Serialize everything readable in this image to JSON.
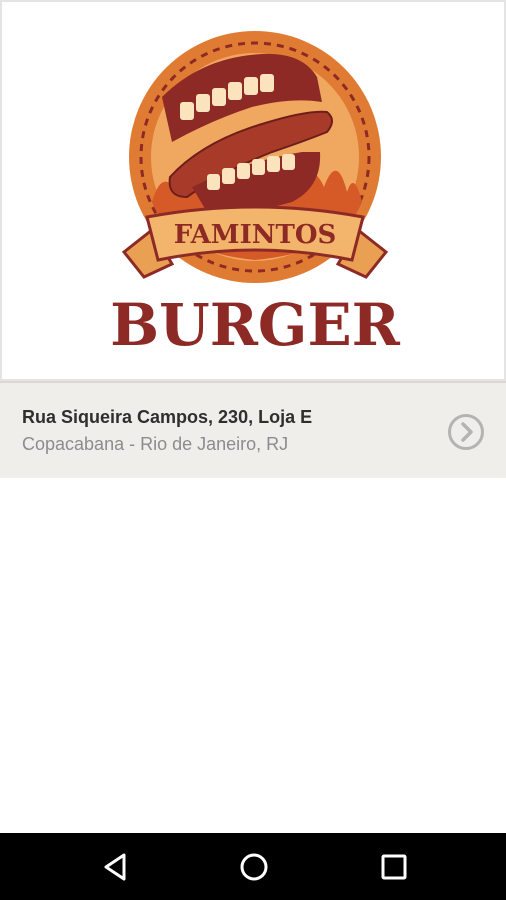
{
  "logo": {
    "banner_text": "FAMINTOS",
    "wordmark": "BURGER",
    "colors": {
      "maroon": "#8e2a25",
      "orange": "#e07b33",
      "light_orange": "#f0a860",
      "banner": "#f3b56b",
      "cream": "#fbe3bd"
    }
  },
  "store": {
    "address_line1": "Rua Siqueira Campos, 230, Loja E",
    "address_line2": "Copacabana - Rio de Janeiro, RJ",
    "action_icon": "chevron-right-circle-icon"
  },
  "navigation": {
    "back_icon": "back-triangle-icon",
    "home_icon": "home-circle-icon",
    "recents_icon": "recents-square-icon"
  }
}
